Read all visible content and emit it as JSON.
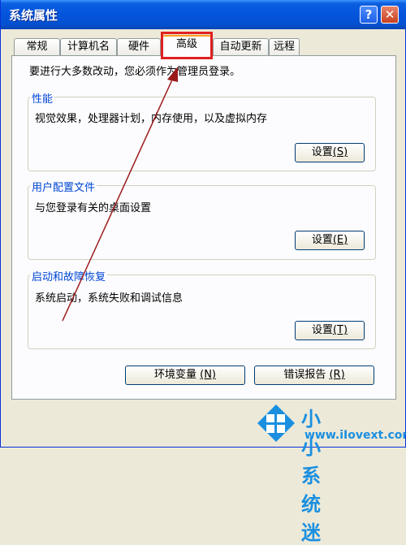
{
  "window": {
    "title": "系统属性",
    "help_label": "?",
    "close_label": "✕"
  },
  "tabs": [
    {
      "label": "常规",
      "active": false
    },
    {
      "label": "计算机名",
      "active": false
    },
    {
      "label": "硬件",
      "active": false
    },
    {
      "label": "高级",
      "active": true
    },
    {
      "label": "自动更新",
      "active": false
    },
    {
      "label": "远程",
      "active": false
    }
  ],
  "admin_note": "要进行大多数改动，您必须作为管理员登录。",
  "groups": {
    "performance": {
      "title": "性能",
      "description": "视觉效果，处理器计划，内存使用，以及虚拟内存",
      "button": "设置",
      "mnemonic": "(S)"
    },
    "user_profiles": {
      "title": "用户配置文件",
      "description": "与您登录有关的桌面设置",
      "button": "设置",
      "mnemonic": "(E)"
    },
    "startup_recovery": {
      "title": "启动和故障恢复",
      "description": "系统启动，系统失败和调试信息",
      "button": "设置",
      "mnemonic": "(T)"
    }
  },
  "bottom_buttons": {
    "env_vars": {
      "label": "环境变量",
      "mnemonic": "(N)"
    },
    "error_report": {
      "label": "错误报告",
      "mnemonic": "(R)"
    }
  },
  "watermark": {
    "title": "小小系统迷",
    "url": "www.iIovext.com"
  },
  "colors": {
    "title_bar": "#0454dc",
    "group_title": "#0046d5",
    "highlight": "#e02020",
    "arrow": "#9b1b1b",
    "watermark": "#1a8fe0"
  },
  "icons": {
    "help": "question-mark-icon",
    "close": "close-x-icon",
    "logo": "windows-logo-icon"
  }
}
